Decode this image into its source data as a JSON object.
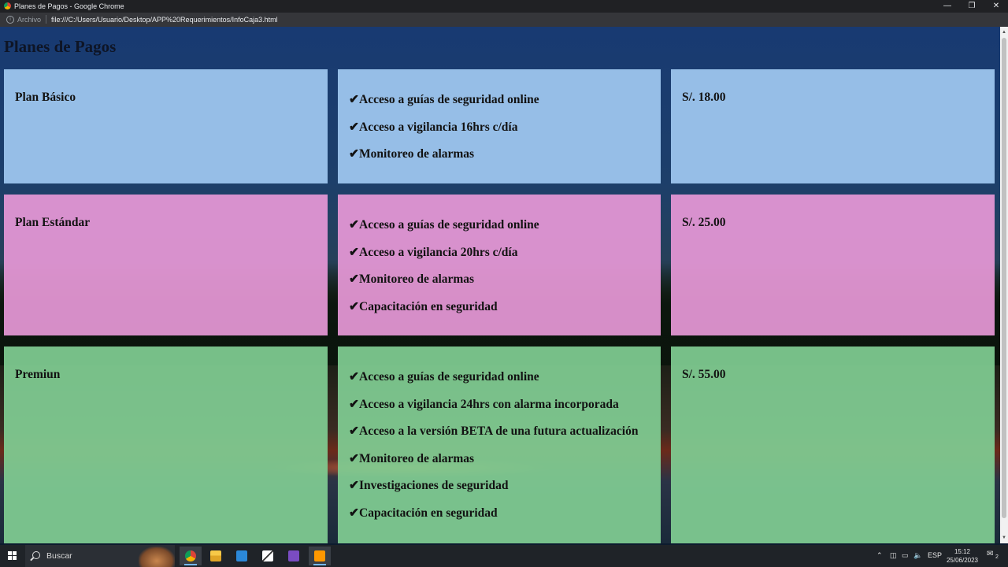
{
  "window": {
    "title": "Planes de Pagos - Google Chrome",
    "controls": [
      "minimize-icon",
      "restore-icon",
      "close-icon"
    ]
  },
  "address_bar": {
    "scheme_label": "Archivo",
    "url": "file:///C:/Users/Usuario/Desktop/APP%20Requerimientos/InfoCaja3.html"
  },
  "page": {
    "title": "Planes de Pagos",
    "plans": [
      {
        "name": "Plan Básico",
        "price": "S/. 18.00",
        "color": "#9bc4ec",
        "features": [
          "Acceso a guías de seguridad online",
          "Acceso a vigilancia 16hrs c/día",
          "Monitoreo de alarmas"
        ]
      },
      {
        "name": "Plan Estándar",
        "price": "S/. 25.00",
        "color": "#e698d6",
        "features": [
          "Acceso a guías de seguridad online",
          "Acceso a vigilancia 20hrs c/día",
          "Monitoreo de alarmas",
          "Capacitación en seguridad"
        ]
      },
      {
        "name": "Premiun",
        "price": "S/. 55.00",
        "color": "#80cc92",
        "features": [
          "Acceso a guías de seguridad online",
          "Acceso a vigilancia 24hrs con alarma incorporada",
          "Acceso a la versión BETA de una futura actualización",
          "Monitoreo de alarmas",
          "Investigaciones de seguridad",
          "Capacitación en seguridad"
        ]
      }
    ],
    "check_glyph": "✔"
  },
  "taskbar": {
    "search_placeholder": "Buscar",
    "apps": [
      "chrome-icon",
      "file-explorer-icon",
      "store-icon",
      "pen-app-icon",
      "visual-studio-icon",
      "sublime-text-icon"
    ],
    "tray": {
      "language": "ESP",
      "time": "15:12",
      "date": "25/06/2023",
      "notifications": "2"
    }
  }
}
